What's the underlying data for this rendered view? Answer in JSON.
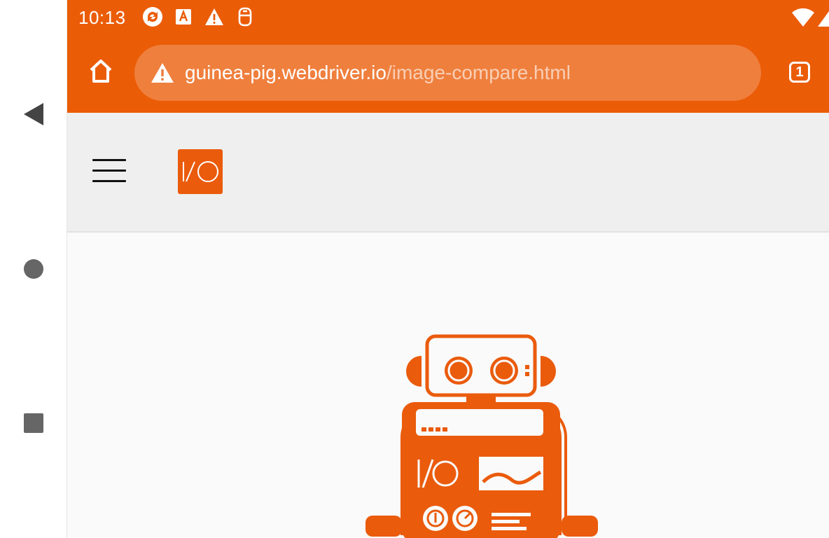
{
  "status_bar": {
    "time": "10:13",
    "icons": [
      "sync-app-icon",
      "font-app-icon",
      "warning-icon",
      "sim-icon"
    ],
    "right_icons": [
      "wifi-icon",
      "signal-icon"
    ]
  },
  "browser": {
    "url": {
      "domain": "guinea-pig.webdriver.io",
      "path": "/image-compare.html"
    },
    "tab_count": "1",
    "colors": {
      "toolbar": "#eb5c07",
      "url_bar": "#ef7f3e"
    }
  },
  "site": {
    "logo_text": "I/O",
    "hero_image": "webdriverio-robot-logo",
    "colors": {
      "brand": "#ea5b0c",
      "header_bg": "#efefef",
      "body_bg": "#fafafa"
    }
  },
  "system_nav": {
    "buttons": [
      "back-icon",
      "home-circle-icon",
      "recents-square-icon"
    ]
  }
}
